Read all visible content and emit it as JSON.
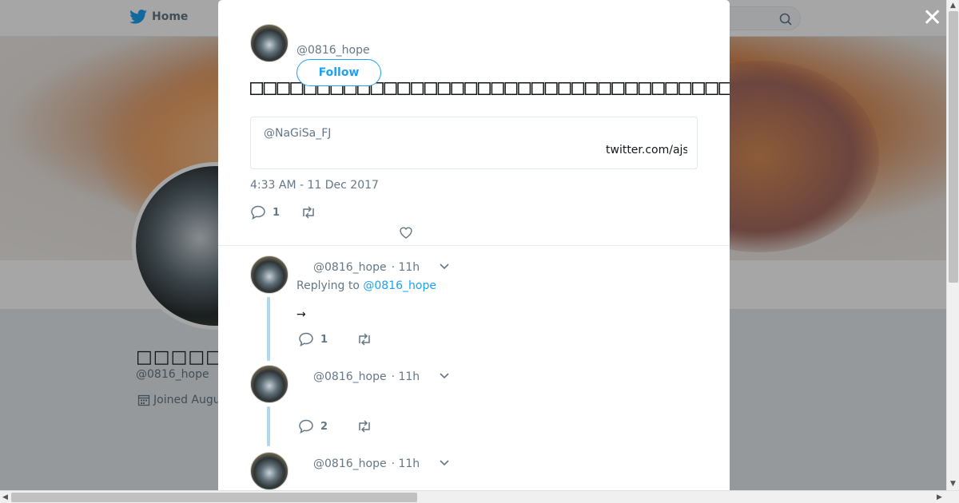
{
  "nav": {
    "home_label": "Home"
  },
  "profile": {
    "name": "□□□□□□□□□□",
    "handle": "@0816_hope",
    "joined": "Joined Augu"
  },
  "modal": {
    "close_label": "✕",
    "tweet": {
      "handle": "@0816_hope",
      "follow_label": "Follow",
      "text": "□□□□□□□□□□□□□□□□□□□□□□□□□□□□□□□□□□□□□□□□□□□□□□□□",
      "quote": {
        "handle": "@NaGiSa_FJ",
        "link": "twitter.com/ajs"
      },
      "timestamp": "4:33 AM - 11 Dec 2017",
      "reply_count": "1"
    },
    "replies": [
      {
        "handle": "@0816_hope",
        "time": "· 11h",
        "replying_prefix": "Replying to",
        "replying_to": "@0816_hope",
        "text": "→",
        "reply_count": "1"
      },
      {
        "handle": "@0816_hope",
        "time": "· 11h",
        "reply_count": "2"
      },
      {
        "handle": "@0816_hope",
        "time": "· 11h"
      }
    ]
  },
  "colors": {
    "accent": "#1da1f2",
    "thread_line": "#b1d6f0",
    "muted": "#657786"
  }
}
